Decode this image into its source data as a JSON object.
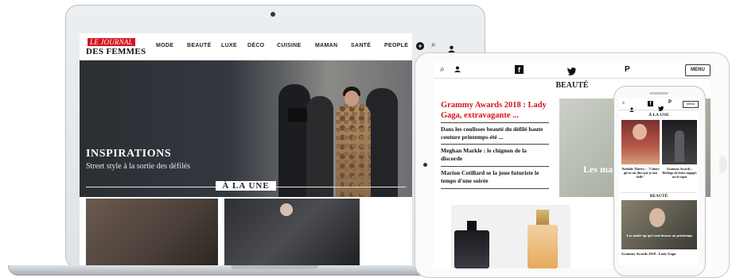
{
  "laptop": {
    "logo_top": "LE JOURNAL",
    "logo_bottom": "DES FEMMES",
    "nav": [
      "MODE",
      "BEAUTÉ",
      "LUXE",
      "DÉCO",
      "CUISINE",
      "MAMAN",
      "SANTÉ",
      "PEOPLE"
    ],
    "hero_title": "INSPIRATIONS",
    "hero_subtitle": "Street style à la sortie des défilés",
    "section_title": "À LA UNE"
  },
  "tablet": {
    "section_title": "BEAUTÉ",
    "menu_label": "MENU",
    "headline": "Grammy Awards 2018 : Lady Gaga, extravagante ...",
    "items": [
      "Dans les coulisses beauté du défilé haute couture printemps-été ...",
      "Meghan Markle : le chignon de la discorde",
      "Marion Cotillard se la joue futuriste le temps d'une soirée"
    ],
    "photo_text": "Les ma buzzer"
  },
  "phone": {
    "menu_label": "MENU",
    "section_one": "À LA UNE",
    "caption_one": "Nathalie Thierry : \"J'adore qu'on me dise que je suis belle\"",
    "caption_two": "Grammy Awards : Herbigo de looks engagés sur le tapis",
    "section_two": "BEAUTÉ",
    "beauty_caption": "Les make-up qui vont buzzer au printemps",
    "bottom_text": "Grammy Awards 2018 : Lady Gaga"
  },
  "icons": {
    "plus": "+",
    "search": "⌕",
    "user": "👤",
    "facebook": "f",
    "twitter": "🐦",
    "pinterest": "P"
  },
  "colors": {
    "brand_red": "#d6131e",
    "hero_dark": "#2b2f33"
  }
}
